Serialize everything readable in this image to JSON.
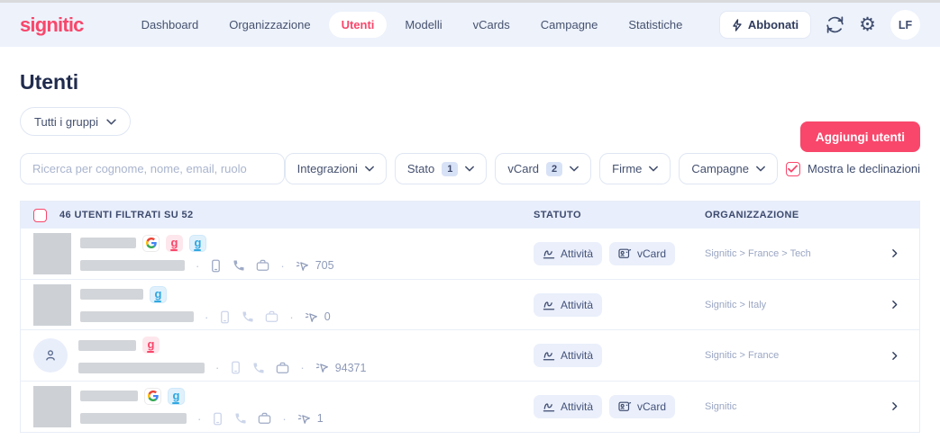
{
  "brand": {
    "logo_text": "signitic"
  },
  "nav": {
    "items": [
      {
        "label": "Dashboard",
        "active": false
      },
      {
        "label": "Organizzazione",
        "active": false
      },
      {
        "label": "Utenti",
        "active": true
      },
      {
        "label": "Modelli",
        "active": false
      },
      {
        "label": "vCards",
        "active": false
      },
      {
        "label": "Campagne",
        "active": false
      },
      {
        "label": "Statistiche",
        "active": false
      }
    ],
    "subscribe_label": "Abbonati",
    "avatar_initials": "LF"
  },
  "page": {
    "title": "Utenti",
    "add_users_button": "Aggiungi utenti",
    "groups_dropdown": "Tutti i gruppi"
  },
  "filters": {
    "search_placeholder": "Ricerca per cognome, nome, email, ruolo",
    "dropdowns": [
      {
        "label": "Integrazioni",
        "count": ""
      },
      {
        "label": "Stato",
        "count": "1"
      },
      {
        "label": "vCard",
        "count": "2"
      },
      {
        "label": "Firme",
        "count": ""
      },
      {
        "label": "Campagne",
        "count": ""
      }
    ],
    "show_declensions_label": "Mostra le declinazioni",
    "show_declensions_checked": true
  },
  "table": {
    "header": {
      "selection_label": "46 UTENTI FILTRATI SU 52",
      "col_status": "STATUTO",
      "col_org": "ORGANIZZAZIONE"
    },
    "badge_labels": {
      "activity": "Attività",
      "vcard": "vCard"
    },
    "rows": [
      {
        "avatar": "blurred",
        "name_bar_w": 62,
        "email_bar_w": 116,
        "integrations": [
          "google",
          "signitic-red",
          "signitic-blue"
        ],
        "meta": {
          "mobile": "med",
          "phone": "med",
          "case": "med"
        },
        "signatures": "705",
        "badges": [
          "activity",
          "vcard"
        ],
        "org": "Signitic > France > Tech"
      },
      {
        "avatar": "blurred",
        "name_bar_w": 70,
        "email_bar_w": 126,
        "integrations": [
          "signitic-blue"
        ],
        "meta": {
          "mobile": "light",
          "phone": "light",
          "case": "light"
        },
        "signatures": "0",
        "badges": [
          "activity"
        ],
        "org": "Signitic > Italy"
      },
      {
        "avatar": "person",
        "name_bar_w": 64,
        "email_bar_w": 140,
        "integrations": [
          "signitic-red"
        ],
        "meta": {
          "mobile": "light",
          "phone": "light",
          "case": "med"
        },
        "signatures": "94371",
        "badges": [
          "activity"
        ],
        "org": "Signitic > France"
      },
      {
        "avatar": "blurred",
        "name_bar_w": 64,
        "email_bar_w": 118,
        "integrations": [
          "google",
          "signitic-blue"
        ],
        "meta": {
          "mobile": "light",
          "phone": "light",
          "case": "med"
        },
        "signatures": "1",
        "badges": [
          "activity",
          "vcard"
        ],
        "org": "Signitic"
      }
    ]
  },
  "colors": {
    "accent_pink": "#f8476b",
    "nav_bg": "#edf2fb",
    "table_header_bg": "#e8eefb",
    "badge_bg": "#eaeffb",
    "signitic_blue": "#2fa7e1",
    "meta_med": "#9fabc6",
    "meta_light": "#ccd5ea",
    "org_text": "#9aa6c3"
  }
}
